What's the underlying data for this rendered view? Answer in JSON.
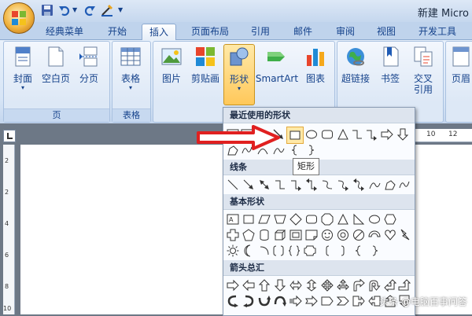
{
  "window": {
    "title": "新建 Micro"
  },
  "tabs": [
    {
      "label": "经典菜单"
    },
    {
      "label": "开始"
    },
    {
      "label": "插入"
    },
    {
      "label": "页面布局"
    },
    {
      "label": "引用"
    },
    {
      "label": "邮件"
    },
    {
      "label": "审阅"
    },
    {
      "label": "视图"
    },
    {
      "label": "开发工具"
    }
  ],
  "active_tab": "插入",
  "ribbon": {
    "pages_group": {
      "label": "页",
      "cover": "封面",
      "blank": "空白页",
      "break": "分页"
    },
    "table_group": {
      "label": "表格",
      "table": "表格"
    },
    "illustrations": {
      "picture": "图片",
      "clipart": "剪贴画",
      "shapes": "形状",
      "smartart": "SmartArt",
      "chart": "图表"
    },
    "links": {
      "hyperlink": "超链接",
      "bookmark": "书签",
      "crossref_line1": "交叉",
      "crossref_line2": "引用"
    },
    "header": {
      "label": "页眉"
    }
  },
  "ruler": {
    "mark_10": "10",
    "mark_12": "12",
    "vmarks": [
      "2",
      "2",
      "4",
      "6",
      "8",
      "10"
    ]
  },
  "shapes_menu": {
    "recent_header": "最近使用的形状",
    "lines_header": "线条",
    "basic_header": "基本形状",
    "arrows_header": "箭头总汇",
    "tooltip": "矩形"
  },
  "watermark": "头条 @电脑百事问答",
  "colors": {
    "accent": "#15428b",
    "ribbon": "#dde8f6",
    "highlight": "#ffc85a",
    "arrow": "#e02020"
  },
  "icons": [
    "office-button-icon",
    "save-icon",
    "undo-icon",
    "redo-icon",
    "format-painter-icon",
    "cover-page-icon",
    "blank-page-icon",
    "page-break-icon",
    "table-icon",
    "picture-icon",
    "clipart-icon",
    "shapes-icon",
    "smartart-icon",
    "chart-icon",
    "hyperlink-icon",
    "bookmark-icon",
    "cross-reference-icon",
    "header-icon"
  ]
}
